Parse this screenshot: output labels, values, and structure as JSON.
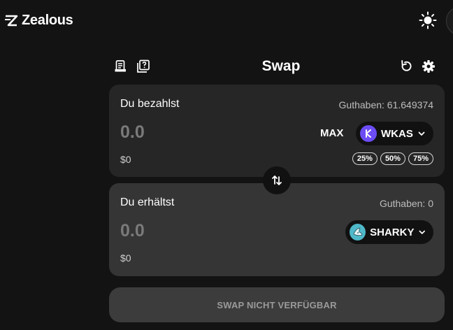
{
  "brand": {
    "name": "Zealous"
  },
  "swap": {
    "title": "Swap",
    "pay": {
      "label": "Du bezahlst",
      "balance": "Guthaben: 61.649374",
      "amount": "0.0",
      "usd": "$0",
      "max_label": "MAX",
      "token": "WKAS",
      "percent_options": [
        "25%",
        "50%",
        "75%"
      ]
    },
    "receive": {
      "label": "Du erhältst",
      "balance": "Guthaben: 0",
      "amount": "0.0",
      "usd": "$0",
      "token": "SHARKY"
    },
    "cta": "SWAP NICHT VERFÜGBAR"
  },
  "icons": {
    "header_left": [
      "receipt-icon",
      "help-book-icon"
    ],
    "header_right": [
      "refresh-icon",
      "settings-gear-icon"
    ],
    "theme": "sun-icon",
    "switch": "swap-arrows-icon"
  },
  "colors": {
    "background": "#131313",
    "pay_card": "#262626",
    "receive_card": "#353535",
    "wkas_token": "#6c4cf5",
    "sharky_token": "#4fb8c9",
    "cta_disabled": "#3c3c3c"
  }
}
